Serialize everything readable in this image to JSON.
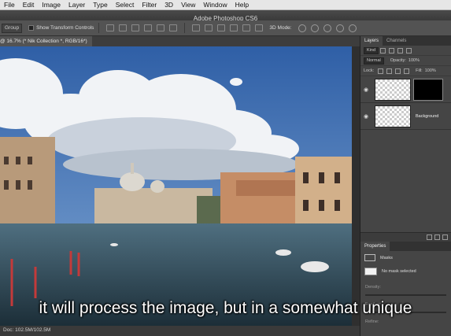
{
  "menubar": {
    "items": [
      "File",
      "Edit",
      "Image",
      "Layer",
      "Type",
      "Select",
      "Filter",
      "3D",
      "View",
      "Window",
      "Help"
    ]
  },
  "titlebar": {
    "title": "Adobe Photoshop CS6"
  },
  "options_bar": {
    "auto_select": "Group",
    "transform_label": "Show Transform Controls",
    "mode_3d": "3D Mode:"
  },
  "document": {
    "tab_title": "@ 16.7% (* Nik Collection *, RGB/16*)",
    "status": "Doc: 102.5M/102.5M"
  },
  "panels": {
    "layers_tab": "Layers",
    "channels_tab": "Channels",
    "kind_label": "Kind",
    "blend_mode": "Normal",
    "opacity_label": "Opacity:",
    "opacity_value": "100%",
    "lock_label": "Lock:",
    "fill_label": "Fill:",
    "fill_value": "100%",
    "layers": [
      {
        "name": ""
      },
      {
        "name": "Background"
      }
    ],
    "properties_tab": "Properties",
    "masks_label": "Masks",
    "no_mask": "No mask selected",
    "density_label": "Density:",
    "feather_label": "Feather:",
    "refine_label": "Refine:"
  },
  "subtitle": {
    "text": "it will process the image, but in a somewhat unique"
  },
  "colors": {
    "ui_dark": "#262626",
    "panel": "#454545",
    "sky": "#3e6fb3",
    "water": "#2f4a5a"
  }
}
